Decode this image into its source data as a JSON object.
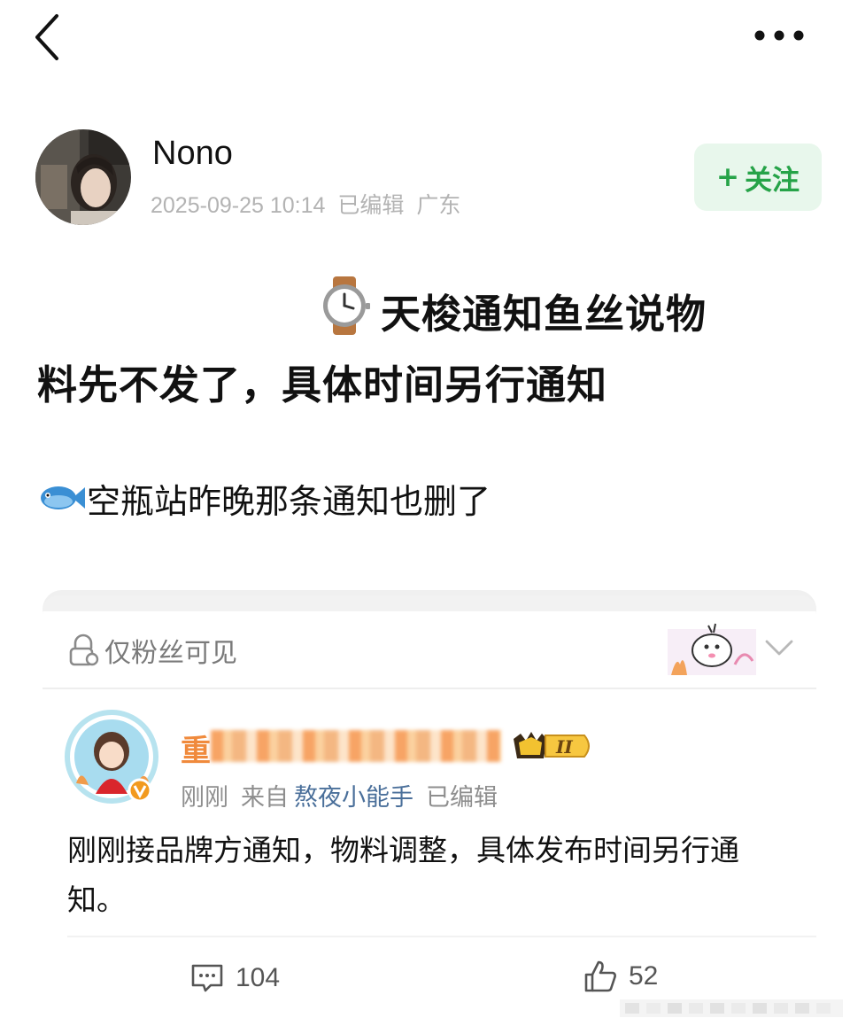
{
  "top_bar": {
    "back_icon": "chevron-left-icon",
    "more_icon": "more-horizontal-icon"
  },
  "author": {
    "name": "Nono",
    "date": "2025-09-25 10:14",
    "edited": "已编辑",
    "location": "广东",
    "follow_label": "关注",
    "follow_plus": "+",
    "follow_color": "#26a348"
  },
  "post": {
    "line1": "天梭通知鱼丝说物",
    "line2": "料先不发了，具体时间另行通知",
    "line3": "空瓶站昨晚那条通知也删了",
    "emoji1": "watch-emoji",
    "emoji2": "fish-emoji"
  },
  "card": {
    "visibility_label": "仅粉丝可见",
    "commenter_name_visible": "重",
    "level_badge": "II",
    "time": "刚刚",
    "from_label": "来自",
    "source": "熬夜小能手",
    "edited": "已编辑",
    "text": "刚刚接品牌方通知，物料调整，具体发布时间另行通知。",
    "comment_count": "104",
    "like_count": "52",
    "link_color": "#4a6f9a"
  }
}
